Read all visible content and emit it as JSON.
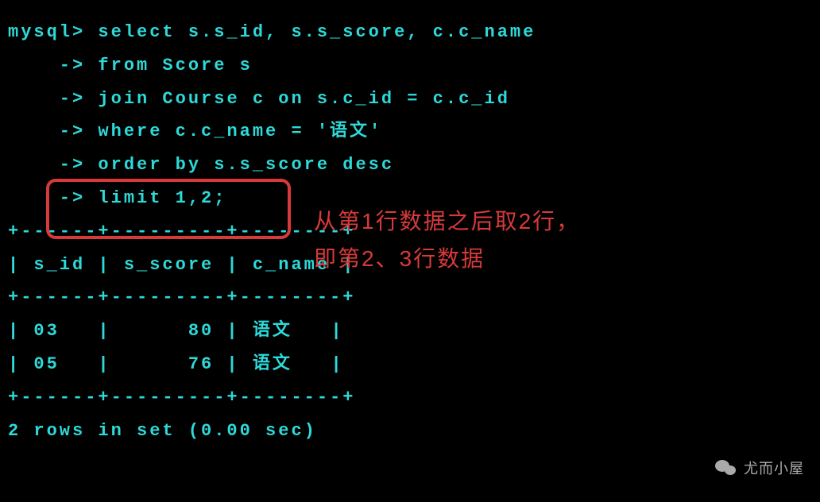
{
  "terminal": {
    "prompt": "mysql>",
    "continuation": "    ->",
    "query_lines": [
      " select s.s_id, s.s_score, c.c_name",
      " from Score s",
      " join Course c on s.c_id = c.c_id",
      " where c.c_name = '语文'",
      " order by s.s_score desc",
      " limit 1,2;"
    ],
    "table_border": "+------+---------+--------+",
    "table_header": "| s_id | s_score | c_name |",
    "table_rows": [
      "| 03   |      80 | 语文   |",
      "| 05   |      76 | 语文   |"
    ],
    "result_footer": "2 rows in set (0.00 sec)"
  },
  "annotation": {
    "line1": "从第1行数据之后取2行，",
    "line2": "即第2、3行数据"
  },
  "watermark": {
    "text": "尤而小屋"
  },
  "chart_data": {
    "type": "table",
    "columns": [
      "s_id",
      "s_score",
      "c_name"
    ],
    "rows": [
      {
        "s_id": "03",
        "s_score": 80,
        "c_name": "语文"
      },
      {
        "s_id": "05",
        "s_score": 76,
        "c_name": "语文"
      }
    ],
    "row_count": 2,
    "elapsed_sec": 0.0
  }
}
